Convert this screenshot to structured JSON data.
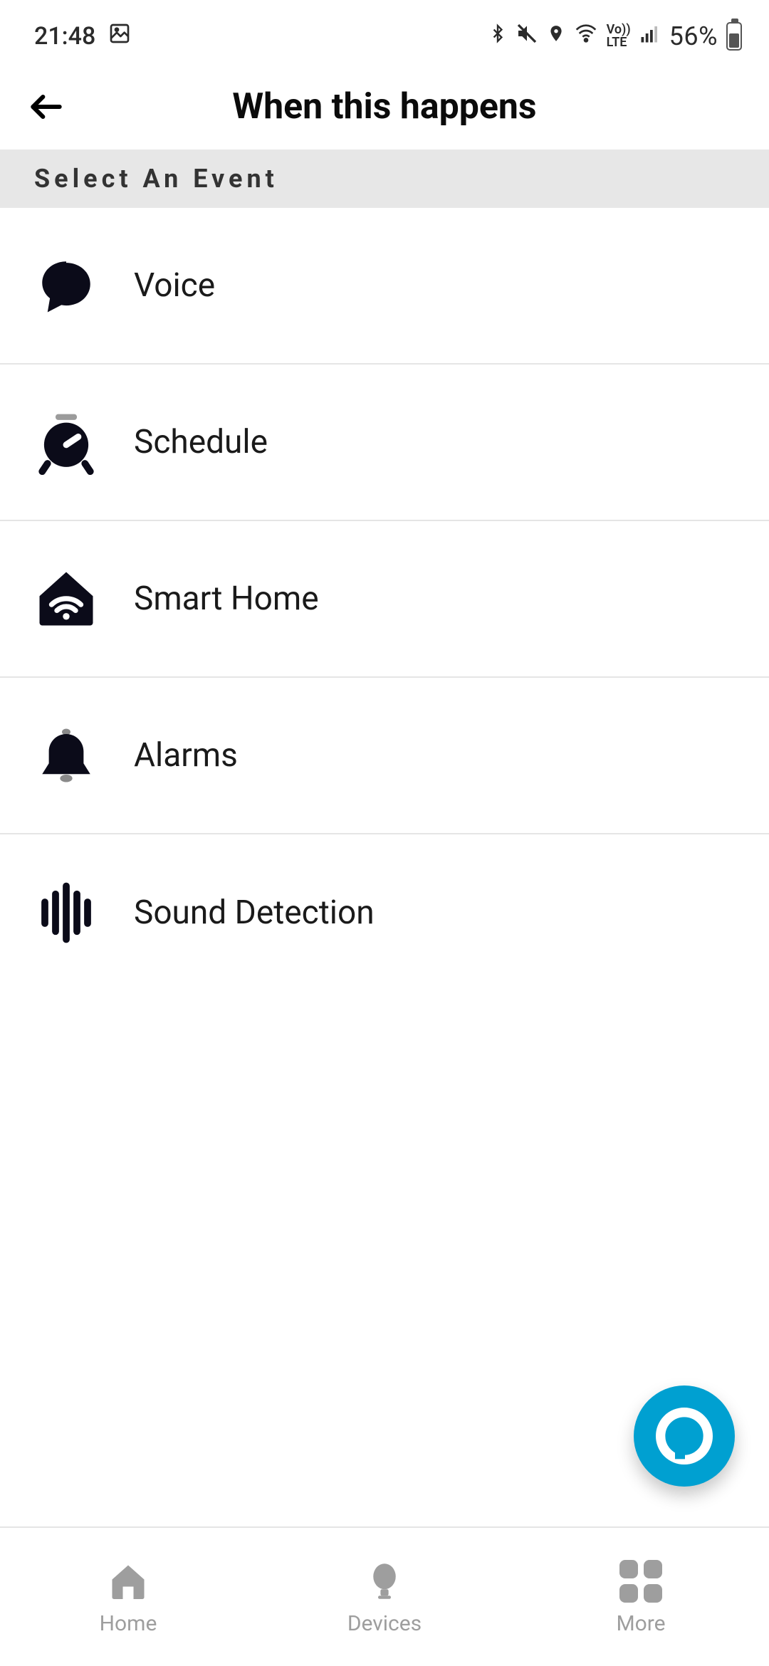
{
  "status": {
    "time": "21:48",
    "battery": "56%"
  },
  "header": {
    "title": "When this happens"
  },
  "section_label": "Select An Event",
  "events": {
    "voice": "Voice",
    "schedule": "Schedule",
    "smart_home": "Smart Home",
    "alarms": "Alarms",
    "sound_detection": "Sound Detection"
  },
  "nav": {
    "home": "Home",
    "devices": "Devices",
    "more": "More"
  }
}
